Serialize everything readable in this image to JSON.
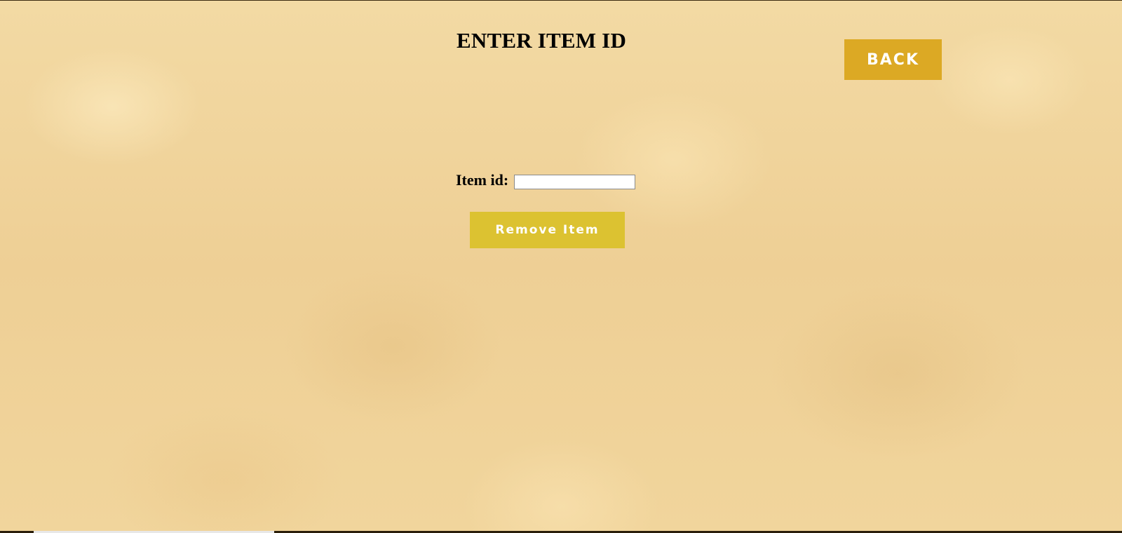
{
  "page": {
    "title": "ENTER ITEM ID"
  },
  "header": {
    "back_label": "BACK"
  },
  "form": {
    "item_id_label": "Item id:",
    "item_id_value": "",
    "item_id_placeholder": "",
    "submit_label": "Remove Item"
  },
  "colors": {
    "back_button": "#dca924",
    "remove_button": "#dcc231",
    "background": "#f1d69c",
    "text": "#000000"
  }
}
